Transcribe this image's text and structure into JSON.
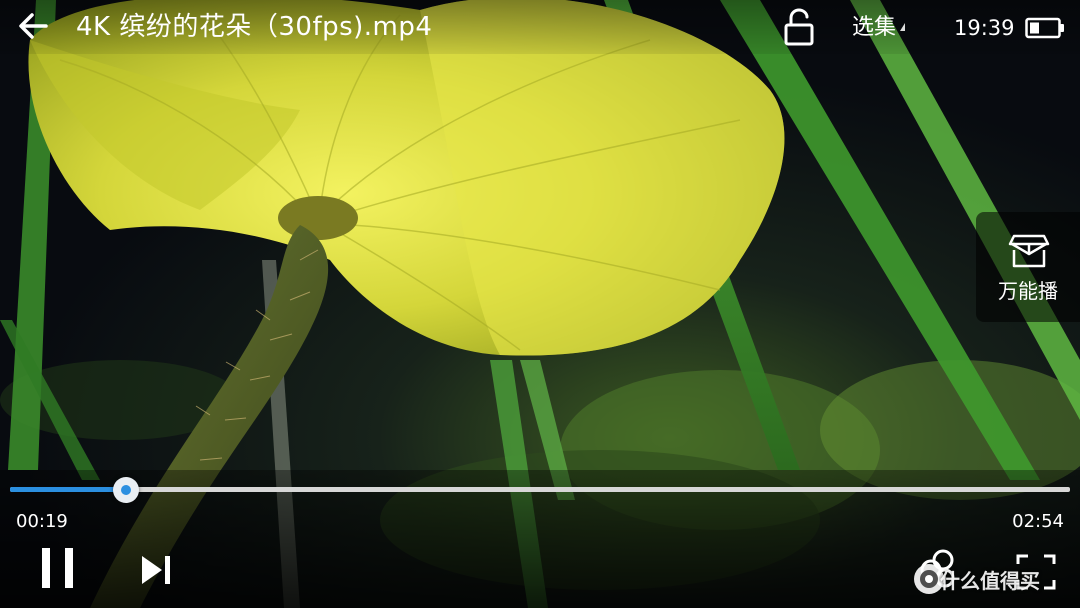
{
  "header": {
    "title": "4K 缤纷的花朵（30fps).mp4",
    "episodes_label": "选集",
    "clock": "19:39",
    "battery_icon": "battery-low-icon"
  },
  "side_panel": {
    "universal_label": "万能播",
    "icon": "box-icon"
  },
  "playback": {
    "current_time": "00:19",
    "total_time": "02:54",
    "progress": 0.109,
    "state": "playing",
    "accent_color": "#2b8fe0"
  },
  "controls": {
    "back_icon": "arrow-left-icon",
    "lock_icon": "lock-open-icon",
    "pause_icon": "pause-icon",
    "next_icon": "skip-next-icon",
    "share_icon": "share-icon",
    "fullscreen_icon": "fullscreen-icon"
  },
  "watermark": {
    "text": "什么值得买"
  },
  "video": {
    "subject": "yellow-poppy-flower",
    "colors": {
      "petal": "#d6d83a",
      "stem": "#5a6a2a",
      "background": "#0b0f12",
      "grass": "#3f9a2e"
    }
  }
}
